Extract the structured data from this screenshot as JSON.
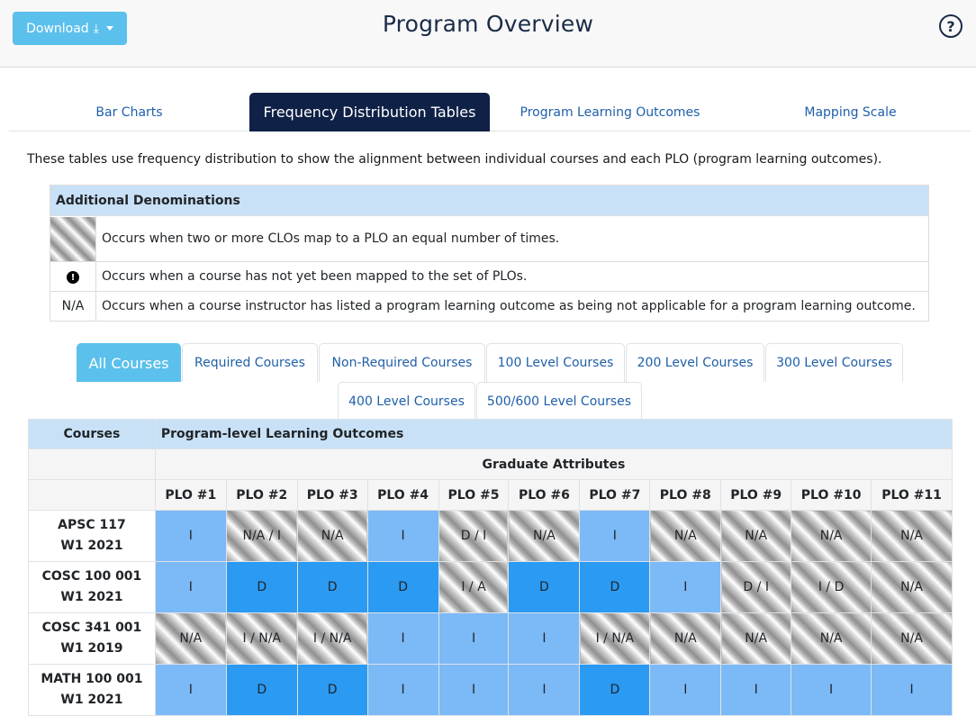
{
  "header": {
    "download_label": "Download",
    "title": "Program Overview",
    "help_label": "?"
  },
  "main_tabs": [
    {
      "label": "Bar Charts"
    },
    {
      "label": "Frequency Distribution Tables"
    },
    {
      "label": "Program Learning Outcomes"
    },
    {
      "label": "Mapping Scale"
    }
  ],
  "intro": "These tables use frequency distribution to show the alignment between individual courses and each PLO (program learning outcomes).",
  "denominations": {
    "title": "Additional Denominations",
    "rows": [
      {
        "symbol": "",
        "text": "Occurs when two or more CLOs map to a PLO an equal number of times."
      },
      {
        "symbol": "!",
        "text": "Occurs when a course has not yet been mapped to the set of PLOs."
      },
      {
        "symbol": "N/A",
        "text": "Occurs when a course instructor has listed a program learning outcome as being not applicable for a program learning outcome."
      }
    ]
  },
  "course_tabs": [
    {
      "label": "All Courses"
    },
    {
      "label": "Required Courses"
    },
    {
      "label": "Non-Required Courses"
    },
    {
      "label": "100 Level Courses"
    },
    {
      "label": "200 Level Courses"
    },
    {
      "label": "300 Level Courses"
    },
    {
      "label": "400 Level Courses"
    },
    {
      "label": "500/600 Level Courses"
    }
  ],
  "matrix": {
    "courses_header": "Courses",
    "plo_header": "Program-level Learning Outcomes",
    "graduate_attributes": "Graduate Attributes",
    "plos": [
      "PLO #1",
      "PLO #2",
      "PLO #3",
      "PLO #4",
      "PLO #5",
      "PLO #6",
      "PLO #7",
      "PLO #8",
      "PLO #9",
      "PLO #10",
      "PLO #11"
    ],
    "rows": [
      {
        "course": "APSC 117",
        "term": "W1 2021",
        "cells": [
          "I",
          "N/A / I",
          "N/A",
          "I",
          "D / I",
          "N/A",
          "I",
          "N/A",
          "N/A",
          "N/A",
          "N/A"
        ]
      },
      {
        "course": "COSC 100 001",
        "term": "W1 2021",
        "cells": [
          "I",
          "D",
          "D",
          "D",
          "I / A",
          "D",
          "D",
          "I",
          "D / I",
          "I / D",
          "N/A"
        ]
      },
      {
        "course": "COSC 341 001",
        "term": "W1 2019",
        "cells": [
          "N/A",
          "I / N/A",
          "I / N/A",
          "I",
          "I",
          "I",
          "I / N/A",
          "N/A",
          "N/A",
          "N/A",
          "N/A"
        ]
      },
      {
        "course": "MATH 100 001",
        "term": "W1 2021",
        "cells": [
          "I",
          "D",
          "D",
          "I",
          "I",
          "I",
          "D",
          "I",
          "I",
          "I",
          "I"
        ]
      }
    ],
    "colors": {
      "I": "#7cb9f7",
      "D": "#2a9af3",
      "N/A": "#ffffff"
    }
  }
}
